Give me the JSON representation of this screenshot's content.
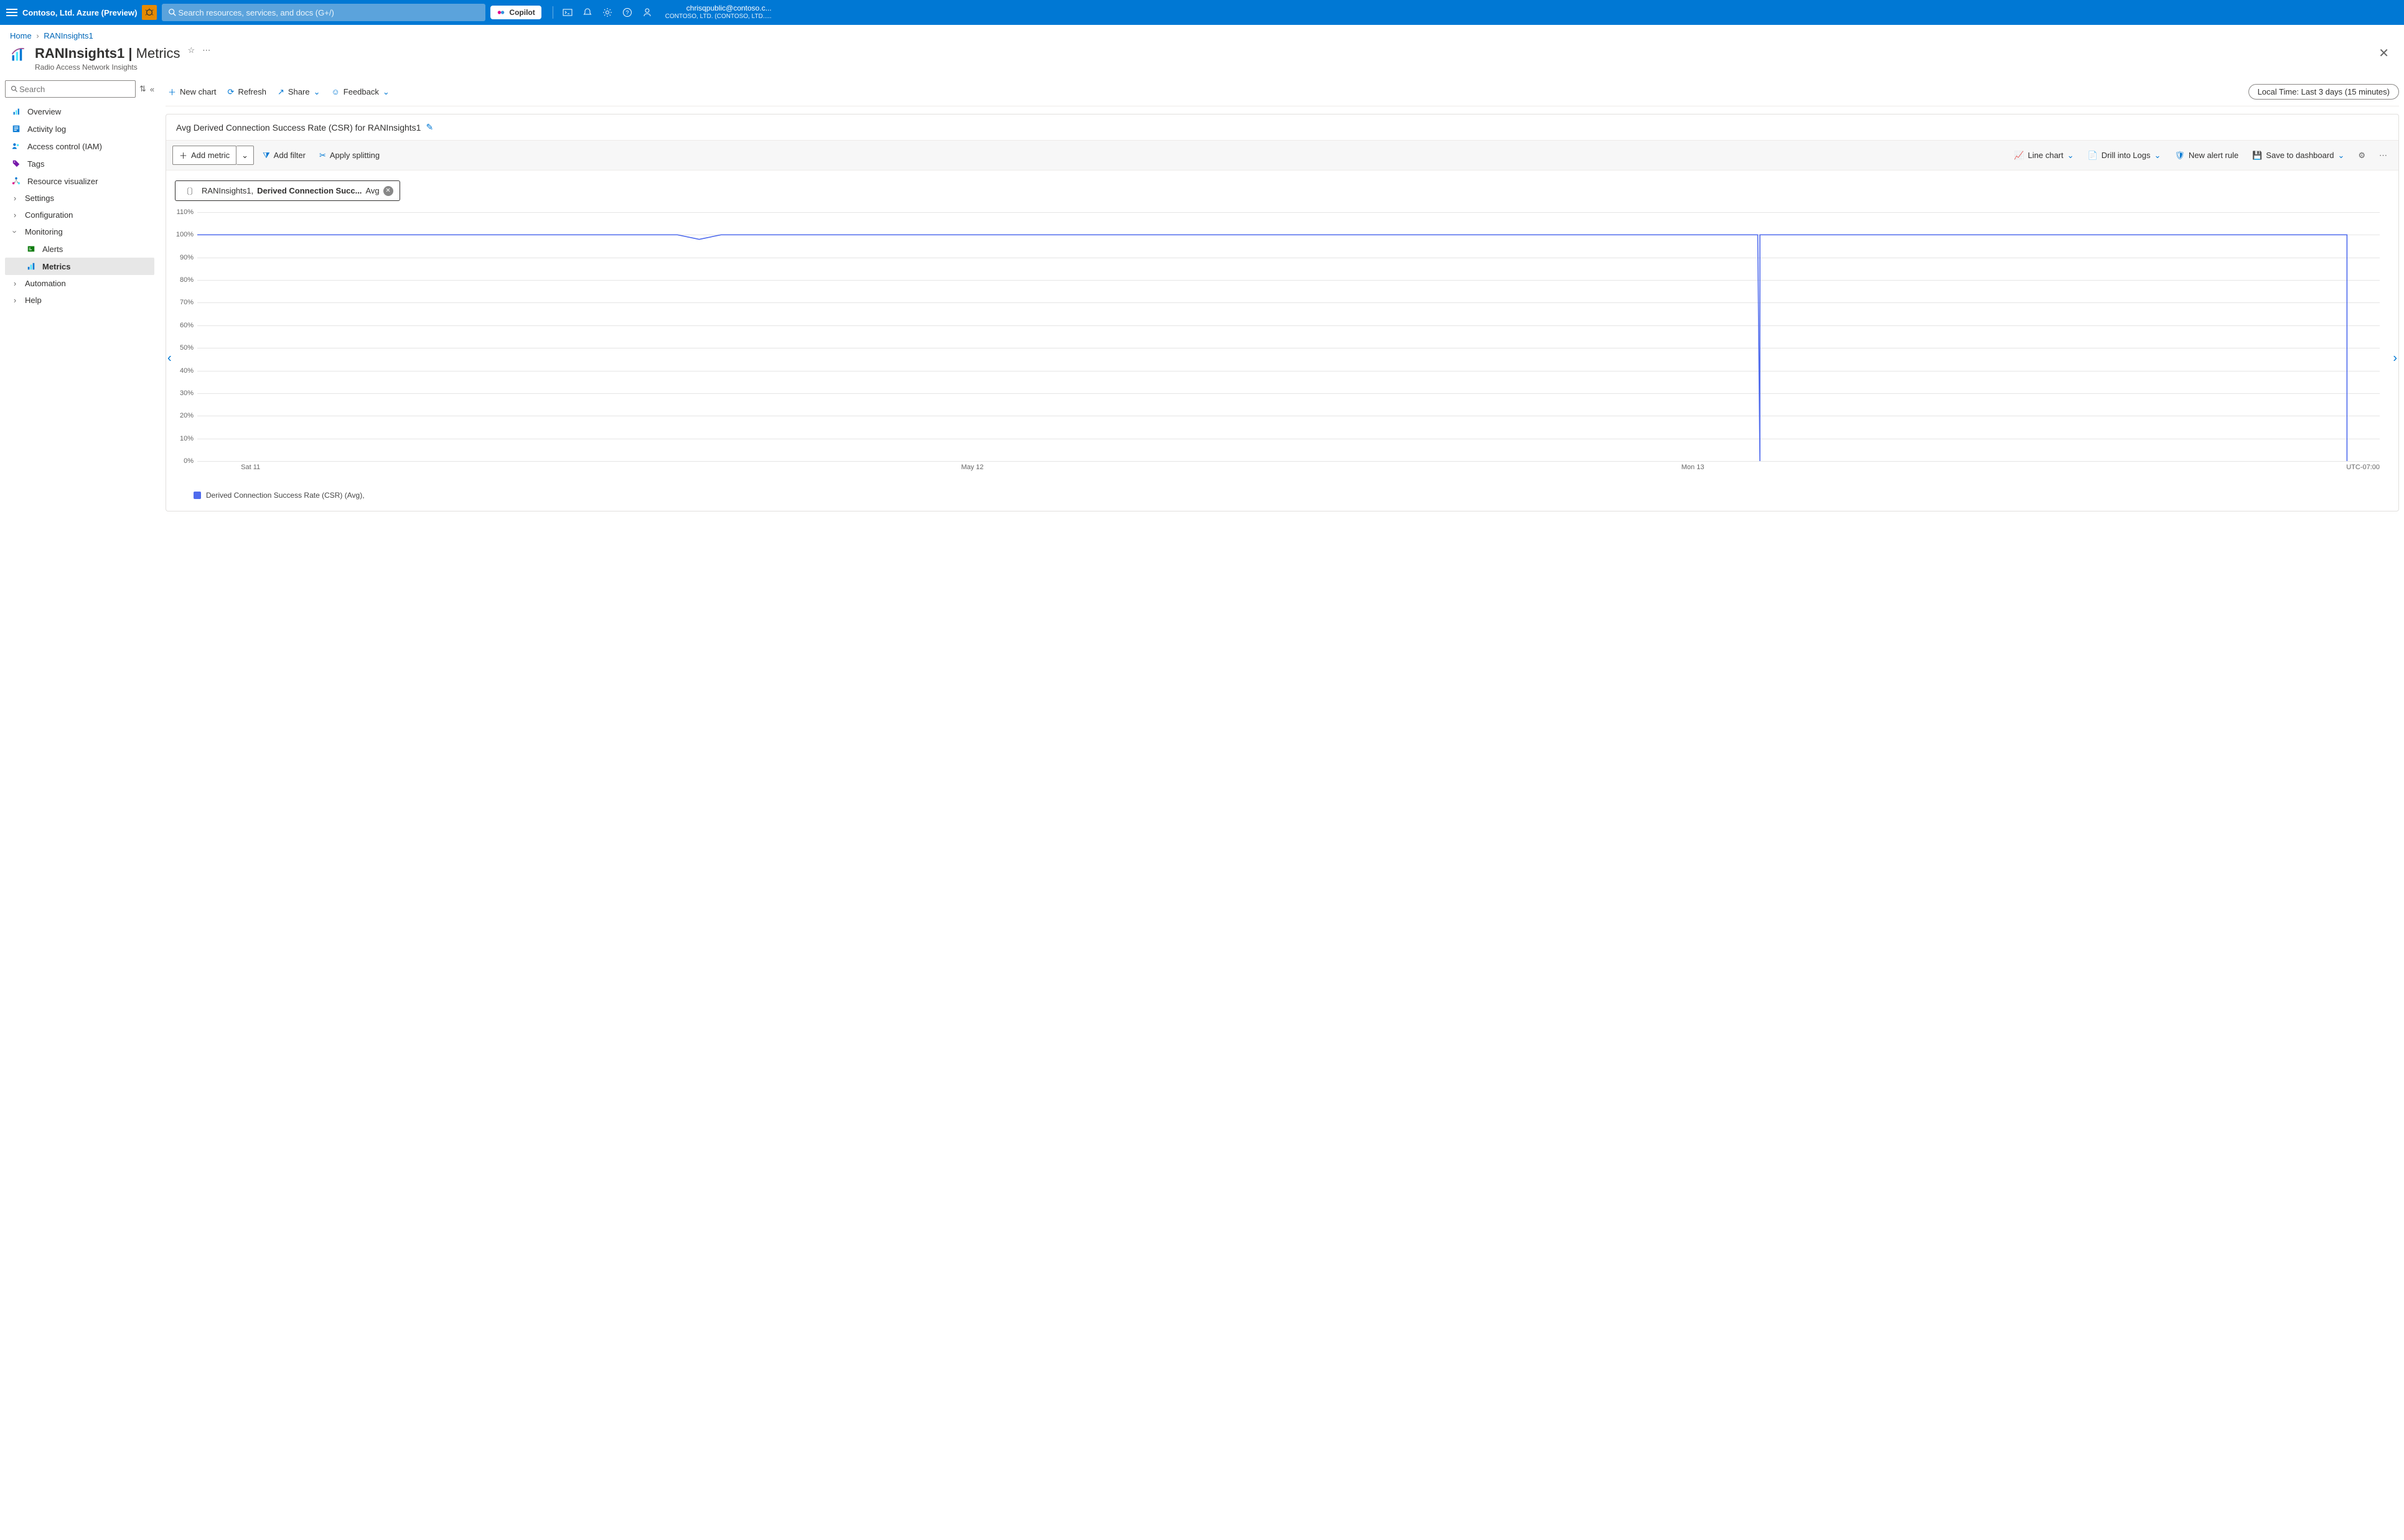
{
  "topbar": {
    "brand": "Contoso, Ltd. Azure (Preview)",
    "search_placeholder": "Search resources, services, and docs (G+/)",
    "copilot": "Copilot",
    "account_email": "chrisqpublic@contoso.c...",
    "account_tenant": "CONTOSO, LTD. (CONTOSO, LTD....."
  },
  "breadcrumb": {
    "home": "Home",
    "current": "RANInsights1"
  },
  "page": {
    "title_resource": "RANInsights1",
    "title_section": "Metrics",
    "subtitle": "Radio Access Network Insights"
  },
  "sidebar": {
    "search_placeholder": "Search",
    "items": {
      "overview": "Overview",
      "activity": "Activity log",
      "iam": "Access control (IAM)",
      "tags": "Tags",
      "visualizer": "Resource visualizer",
      "settings": "Settings",
      "configuration": "Configuration",
      "monitoring": "Monitoring",
      "alerts": "Alerts",
      "metrics": "Metrics",
      "automation": "Automation",
      "help": "Help"
    }
  },
  "toolbar": {
    "new_chart": "New chart",
    "refresh": "Refresh",
    "share": "Share",
    "feedback": "Feedback",
    "time": "Local Time: Last 3 days (15 minutes)"
  },
  "card": {
    "title": "Avg Derived Connection Success Rate (CSR) for RANInsights1",
    "add_metric": "Add metric",
    "add_filter": "Add filter",
    "apply_split": "Apply splitting",
    "chart_type": "Line chart",
    "drill_logs": "Drill into Logs",
    "new_alert": "New alert rule",
    "save_dash": "Save to dashboard",
    "chip_resource": "RANInsights1,",
    "chip_metric": "Derived Connection Succ...",
    "chip_agg": "Avg",
    "legend": "Derived Connection Success Rate (CSR) (Avg),",
    "utc": "UTC-07:00"
  },
  "chart_data": {
    "type": "line",
    "title": "Avg Derived Connection Success Rate (CSR) for RANInsights1",
    "xlabel": "",
    "ylabel": "",
    "ylim": [
      0,
      110
    ],
    "y_ticks": [
      "0%",
      "10%",
      "20%",
      "30%",
      "40%",
      "50%",
      "60%",
      "70%",
      "80%",
      "90%",
      "100%",
      "110%"
    ],
    "x_ticks": [
      {
        "label": "Sat 11",
        "pos": 0.02
      },
      {
        "label": "May 12",
        "pos": 0.35
      },
      {
        "label": "Mon 13",
        "pos": 0.68
      }
    ],
    "series": [
      {
        "name": "Derived Connection Success Rate (CSR) (Avg)",
        "color": "#4f6bed",
        "points": [
          {
            "x": 0.0,
            "y": 100
          },
          {
            "x": 0.05,
            "y": 100
          },
          {
            "x": 0.1,
            "y": 100
          },
          {
            "x": 0.15,
            "y": 100
          },
          {
            "x": 0.22,
            "y": 100
          },
          {
            "x": 0.23,
            "y": 98
          },
          {
            "x": 0.24,
            "y": 100
          },
          {
            "x": 0.3,
            "y": 100
          },
          {
            "x": 0.4,
            "y": 100
          },
          {
            "x": 0.5,
            "y": 100
          },
          {
            "x": 0.6,
            "y": 100
          },
          {
            "x": 0.7,
            "y": 100
          },
          {
            "x": 0.715,
            "y": 100
          },
          {
            "x": 0.716,
            "y": 0
          },
          {
            "x": 0.716,
            "y": 100
          },
          {
            "x": 0.725,
            "y": 100
          },
          {
            "x": 0.8,
            "y": 100
          },
          {
            "x": 0.9,
            "y": 100
          },
          {
            "x": 0.98,
            "y": 100
          },
          {
            "x": 0.985,
            "y": 100
          },
          {
            "x": 0.985,
            "y": 0
          }
        ]
      }
    ]
  }
}
